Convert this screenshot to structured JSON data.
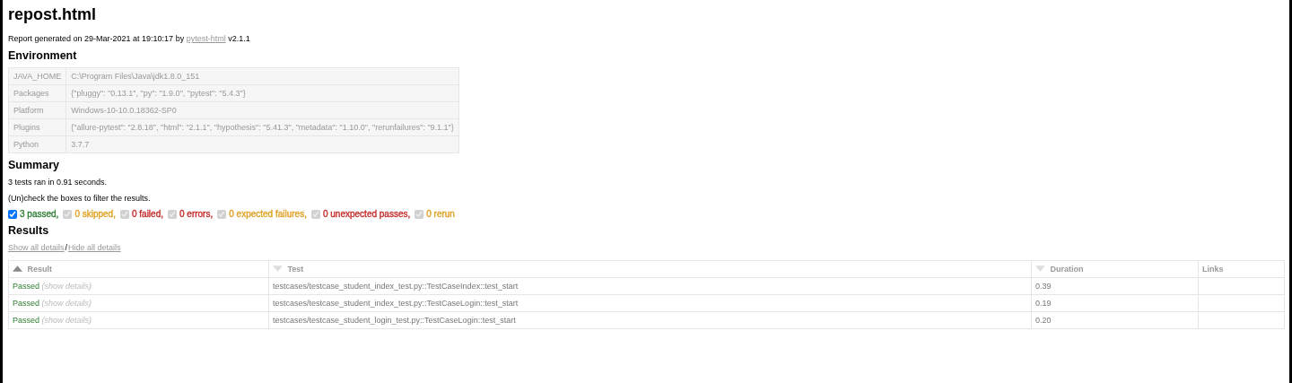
{
  "title": "repost.html",
  "generated": {
    "prefix": "Report generated on 29-Mar-2021 at 19:10:17 by ",
    "link": "pytest-html",
    "suffix": " v2.1.1"
  },
  "environment": {
    "heading": "Environment",
    "rows": [
      {
        "key": "JAVA_HOME",
        "value": "C:\\Program Files\\Java\\jdk1.8.0_151"
      },
      {
        "key": "Packages",
        "value": "{\"pluggy\": \"0.13.1\", \"py\": \"1.9.0\", \"pytest\": \"5.4.3\"}"
      },
      {
        "key": "Platform",
        "value": "Windows-10-10.0.18362-SP0"
      },
      {
        "key": "Plugins",
        "value": "{\"allure-pytest\": \"2.8.18\", \"html\": \"2.1.1\", \"hypothesis\": \"5.41.3\", \"metadata\": \"1.10.0\", \"rerunfailures\": \"9.1.1\"}"
      },
      {
        "key": "Python",
        "value": "3.7.7"
      }
    ]
  },
  "summary": {
    "heading": "Summary",
    "ran": "3 tests ran in 0.91 seconds.",
    "hint": "(Un)check the boxes to filter the results.",
    "filters": [
      {
        "label": "3 passed,",
        "checked": true,
        "disabled": false,
        "color": "#2e7d32"
      },
      {
        "label": "0 skipped,",
        "checked": true,
        "disabled": true,
        "color": "#e0a020"
      },
      {
        "label": "0 failed,",
        "checked": true,
        "disabled": true,
        "color": "#c62828"
      },
      {
        "label": "0 errors,",
        "checked": true,
        "disabled": true,
        "color": "#c62828"
      },
      {
        "label": "0 expected failures,",
        "checked": true,
        "disabled": true,
        "color": "#e0a020"
      },
      {
        "label": "0 unexpected passes,",
        "checked": true,
        "disabled": true,
        "color": "#c62828"
      },
      {
        "label": "0 rerun",
        "checked": true,
        "disabled": true,
        "color": "#e0a020"
      }
    ]
  },
  "results": {
    "heading": "Results",
    "show_all": "Show all details",
    "separator": "/",
    "hide_all": "Hide all details",
    "columns": [
      {
        "label": "Result",
        "sortable": true,
        "ascending": true,
        "sorted": true
      },
      {
        "label": "Test",
        "sortable": true,
        "ascending": false,
        "sorted": false
      },
      {
        "label": "Duration",
        "sortable": true,
        "ascending": false,
        "sorted": false
      },
      {
        "label": "Links",
        "sortable": false
      }
    ],
    "rows": [
      {
        "result": "Passed",
        "details": "(show details)",
        "test": "testcases/testcase_student_index_test.py::TestCaseIndex::test_start",
        "duration": "0.39"
      },
      {
        "result": "Passed",
        "details": "(show details)",
        "test": "testcases/testcase_student_index_test.py::TestCaseLogin::test_start",
        "duration": "0.19"
      },
      {
        "result": "Passed",
        "details": "(show details)",
        "test": "testcases/testcase_student_login_test.py::TestCaseLogin::test_start",
        "duration": "0.20"
      }
    ]
  }
}
